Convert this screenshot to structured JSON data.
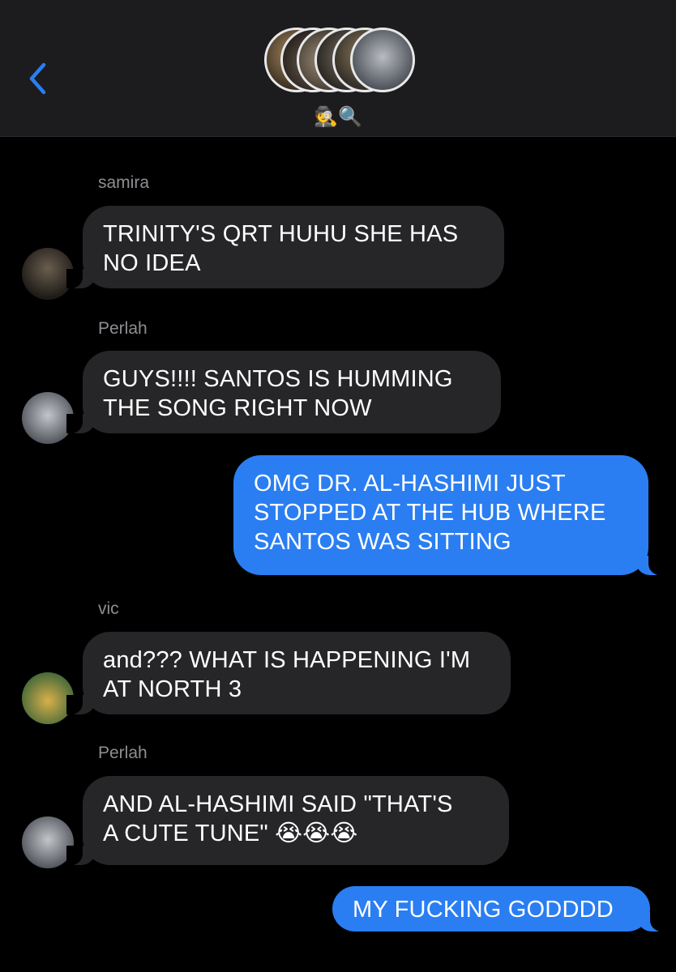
{
  "header": {
    "group_name": "🕵️🔍",
    "back_icon": "chevron-left-icon",
    "accent_color": "#2a7ef2"
  },
  "messages": [
    {
      "sender": "samira",
      "direction": "in",
      "lines": [
        "TRINITY'S QRT HUHU SHE HAS",
        "NO IDEA"
      ]
    },
    {
      "sender": "Perlah",
      "direction": "in",
      "lines": [
        "GUYS!!!! SANTOS IS HUMMING",
        "THE SONG RIGHT NOW"
      ]
    },
    {
      "direction": "out",
      "lines": [
        "OMG DR. AL-HASHIMI JUST",
        "STOPPED AT THE HUB WHERE",
        "SANTOS WAS SITTING"
      ]
    },
    {
      "sender": "vic",
      "direction": "in",
      "lines": [
        "and??? WHAT IS HAPPENING I'M",
        "AT NORTH 3"
      ]
    },
    {
      "sender": "Perlah",
      "direction": "in",
      "lines": [
        "AND AL-HASHIMI SAID \"THAT'S",
        "A CUTE TUNE\" 😭😭😭"
      ]
    },
    {
      "direction": "out",
      "lines": [
        "MY FUCKING GODDDD"
      ]
    }
  ],
  "colors": {
    "incoming_bubble": "#262628",
    "outgoing_bubble": "#2a7ef2",
    "header_bg": "#1c1c1e",
    "sender_text": "#8e8e93"
  }
}
